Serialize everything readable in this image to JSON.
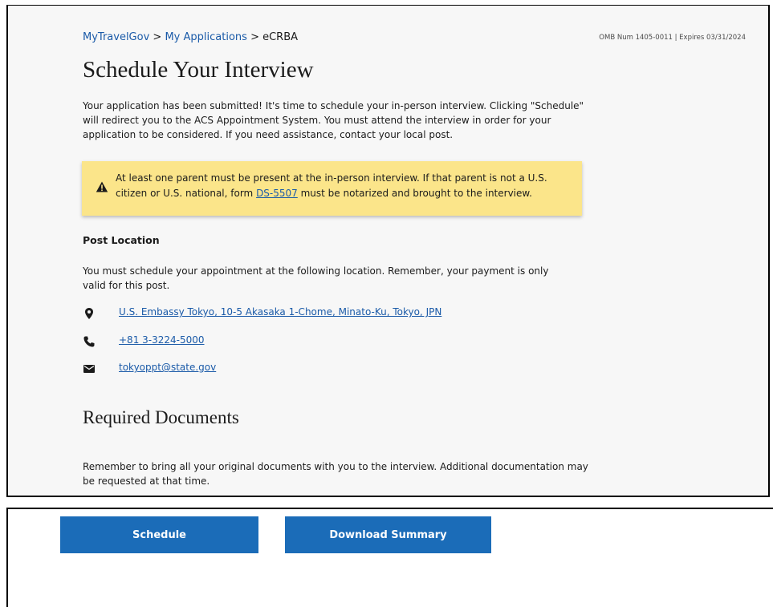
{
  "breadcrumb": {
    "items": [
      "MyTravelGov",
      "My Applications",
      "eCRBA"
    ],
    "separator": ">"
  },
  "omb": "OMB Num 1405-0011 | Expires 03/31/2024",
  "page_title": "Schedule Your Interview",
  "intro": "Your application has been submitted! It's time to schedule your in-person interview. Clicking \"Schedule\" will redirect you to the ACS Appointment System. You must attend the interview in order for your application to be considered. If you need assistance, contact your local post.",
  "alert": {
    "text_before": "At least one parent must be present at the in-person interview. If that parent is not a U.S. citizen or U.S. national, form ",
    "link": "DS-5507",
    "text_after": " must be notarized and brought to the interview.",
    "icon": "warning-icon"
  },
  "post_location": {
    "heading": "Post Location",
    "description": "You must schedule your appointment at the following location. Remember, your payment is only valid for this post.",
    "address": "U.S. Embassy Tokyo, 10-5 Akasaka 1-Chome, Minato-Ku, Tokyo, JPN",
    "phone": "+81 3-3224-5000",
    "email": "tokyoppt@state.gov"
  },
  "required_documents": {
    "heading": "Required Documents",
    "description": "Remember to bring all your original documents with you to the interview. Additional documentation may be requested at that time."
  },
  "actions": {
    "schedule_label": "Schedule",
    "download_label": "Download Summary"
  },
  "colors": {
    "link": "#1a5aa8",
    "button": "#1b6cb8",
    "alert_bg": "#fbe58a",
    "panel_bg": "#f7f7f7"
  }
}
